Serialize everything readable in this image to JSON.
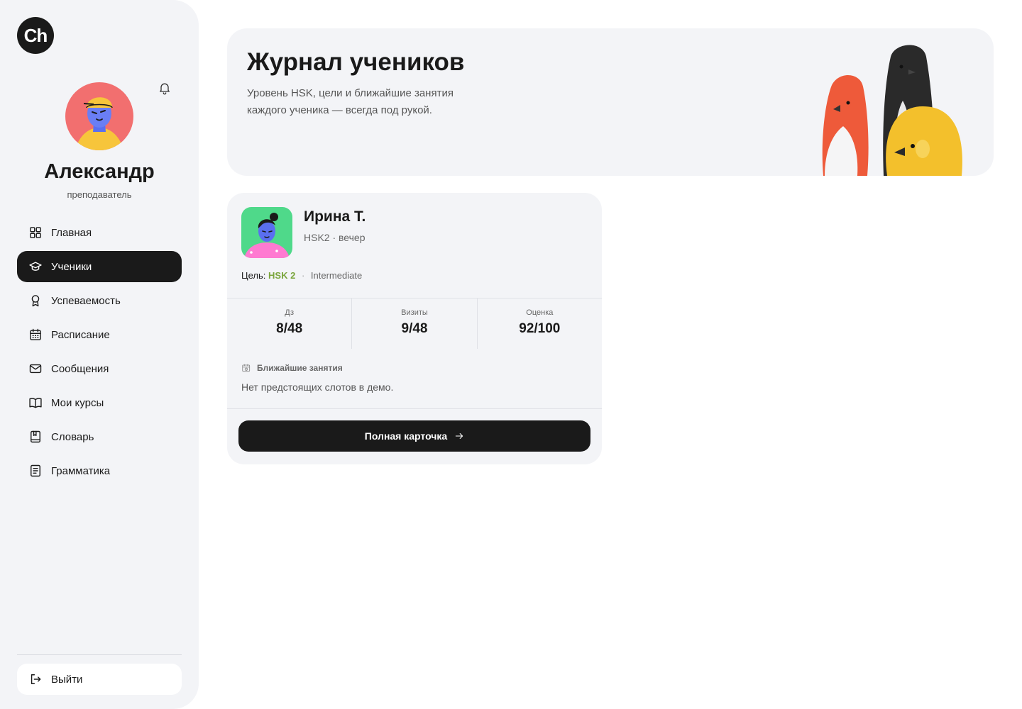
{
  "brand": {
    "logo_text": "Ch"
  },
  "user": {
    "name": "Александр",
    "role": "преподаватель"
  },
  "nav": {
    "items": [
      {
        "label": "Главная",
        "icon": "grid-icon",
        "active": false
      },
      {
        "label": "Ученики",
        "icon": "graduation-cap-icon",
        "active": true
      },
      {
        "label": "Успеваемость",
        "icon": "award-icon",
        "active": false
      },
      {
        "label": "Расписание",
        "icon": "calendar-icon",
        "active": false
      },
      {
        "label": "Сообщения",
        "icon": "mail-icon",
        "active": false
      },
      {
        "label": "Мои курсы",
        "icon": "book-open-icon",
        "active": false
      },
      {
        "label": "Словарь",
        "icon": "dictionary-icon",
        "active": false
      },
      {
        "label": "Грамматика",
        "icon": "notebook-icon",
        "active": false
      }
    ],
    "logout_label": "Выйти"
  },
  "hero": {
    "title": "Журнал учеников",
    "subtitle": "Уровень HSK, цели и ближайшие занятия каждого ученика — всегда под рукой."
  },
  "student": {
    "name": "Ирина Т.",
    "meta": "HSK2 · вечер",
    "goal_label": "Цель:",
    "goal_value": "HSK 2",
    "goal_separator": "·",
    "goal_level": "Intermediate",
    "stats": [
      {
        "label": "Дз",
        "value": "8/48"
      },
      {
        "label": "Визиты",
        "value": "9/48"
      },
      {
        "label": "Оценка",
        "value": "92/100"
      }
    ],
    "upcoming_title": "Ближайшие занятия",
    "upcoming_text": "Нет предстоящих слотов в демо.",
    "button_label": "Полная карточка"
  },
  "colors": {
    "sidebar_bg": "#f3f4f7",
    "active_nav": "#1a1a1a",
    "goal_accent": "#7aa53c",
    "card_bg": "#f3f4f7"
  }
}
